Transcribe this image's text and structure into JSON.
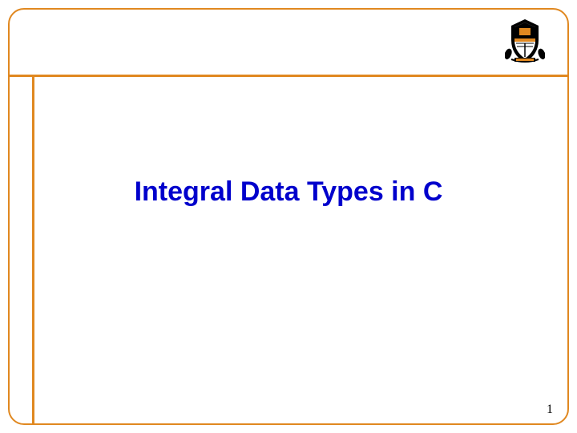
{
  "slide": {
    "title": "Integral Data Types in C",
    "page_number": "1",
    "logo_alt": "Princeton University Shield"
  },
  "colors": {
    "border": "#e08820",
    "title": "#0000cc"
  }
}
